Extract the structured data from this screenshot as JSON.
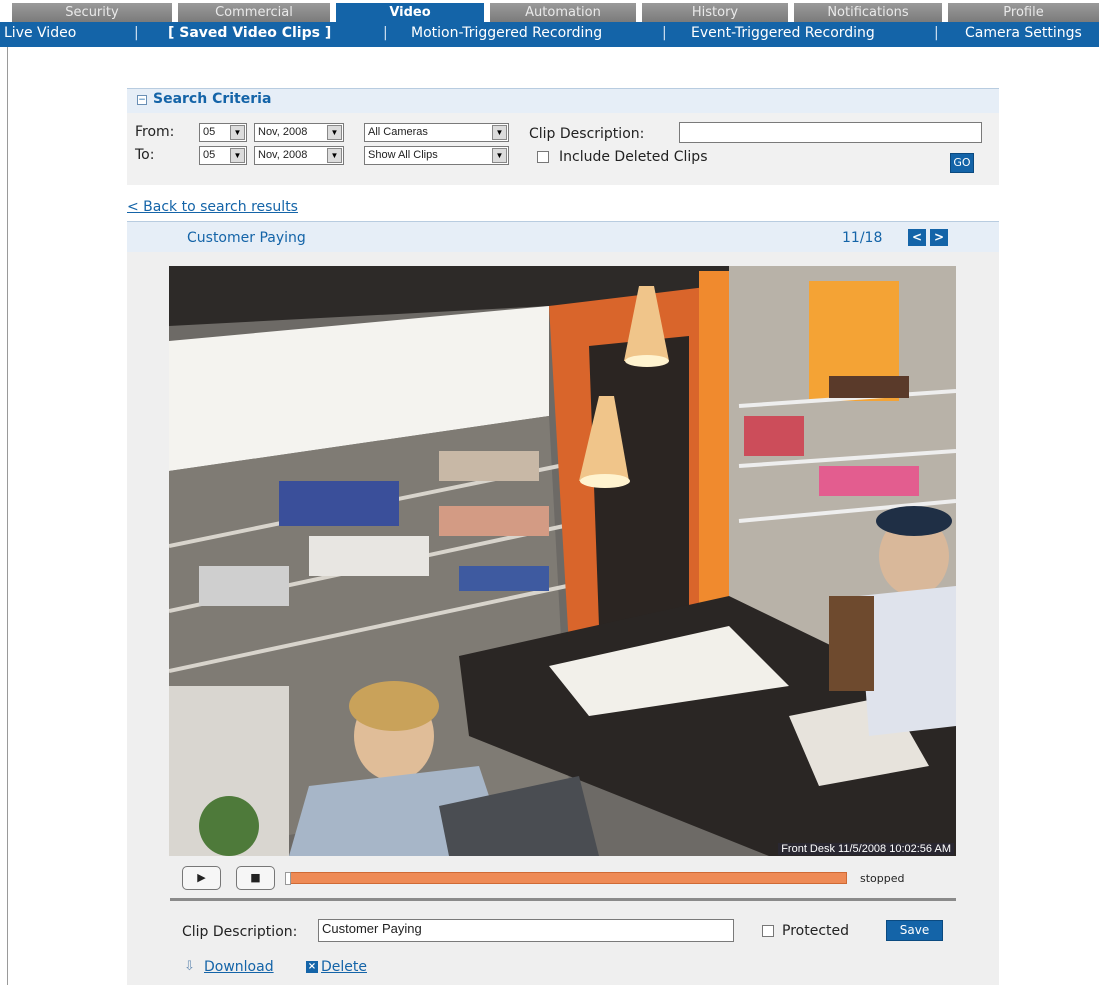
{
  "tabs": [
    {
      "label": "Security",
      "active": false
    },
    {
      "label": "Commercial",
      "active": false
    },
    {
      "label": "Video",
      "active": true
    },
    {
      "label": "Automation",
      "active": false
    },
    {
      "label": "History",
      "active": false
    },
    {
      "label": "Notifications",
      "active": false
    },
    {
      "label": "Profile",
      "active": false
    }
  ],
  "subnav": {
    "items": [
      "Live Video",
      "[ Saved Video Clips ]",
      "Motion-Triggered Recording",
      "Event-Triggered Recording",
      "Camera Settings"
    ],
    "separator": "|"
  },
  "search": {
    "title": "Search Criteria",
    "collapse_glyph": "−",
    "from_label": "From:",
    "to_label": "To:",
    "from_day": "05",
    "from_month": "Nov, 2008",
    "to_day": "05",
    "to_month": "Nov, 2008",
    "camera": "All Cameras",
    "clip_filter": "Show All Clips",
    "clip_desc_label": "Clip Description:",
    "clip_desc_value": "",
    "include_deleted_label": "Include Deleted Clips",
    "go_label": "GO"
  },
  "back_link": "< Back to search results",
  "clip": {
    "title": "Customer Paying",
    "counter": "11/18",
    "prev_glyph": "<",
    "next_glyph": ">",
    "stamp": "Front Desk 11/5/2008 10:02:56 AM",
    "play_glyph": "▶",
    "stop_glyph": "■",
    "progress": 0.0,
    "status": "stopped",
    "desc_label": "Clip Description:",
    "desc_value": "Customer Paying",
    "protected_label": "Protected",
    "save_label": "Save",
    "download_label": "Download",
    "delete_label": "Delete",
    "download_glyph": "⇩",
    "delete_glyph": "×"
  },
  "colors": {
    "brand": "#1464a8",
    "progress": "#ee8a55",
    "tab_inactive": "#8a8a8a"
  }
}
